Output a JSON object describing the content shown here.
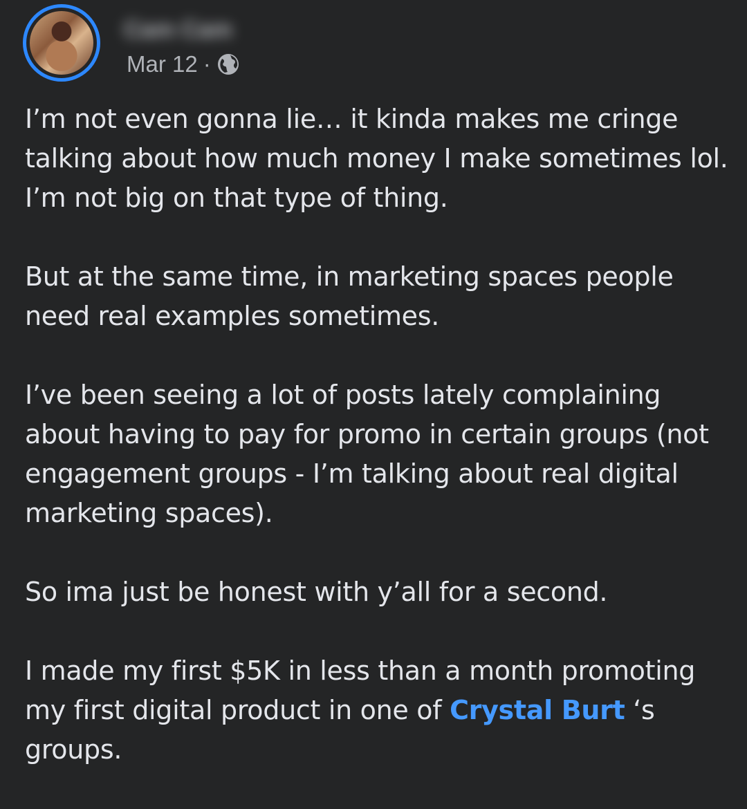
{
  "post": {
    "author": {
      "name": "Cam Cam",
      "avatar_icon": "profile-photo"
    },
    "timestamp": "Mar 12",
    "separator": "·",
    "privacy_icon": "globe-icon",
    "paragraphs": [
      "I’m not even gonna lie… it kinda makes me cringe talking about how much money I make sometimes lol. I’m not big on that type of thing.",
      "But at the same time, in marketing spaces people need real examples sometimes.",
      "I’ve been seeing a lot of posts lately complaining about having to pay for promo in certain groups (not engagement groups - I’m talking about real digital marketing spaces).",
      "So ima just be honest with y’all for a second."
    ],
    "last_paragraph": {
      "before_mention": "I made my first $5K in less than a month promoting my first digital product in one of ",
      "mention": "Crystal Burt",
      "after_mention": " ‘s groups."
    }
  },
  "colors": {
    "background": "#242526",
    "text": "#e4e6eb",
    "secondary_text": "#b0b3b8",
    "mention": "#4599ff",
    "avatar_ring": "#2d88ff"
  }
}
